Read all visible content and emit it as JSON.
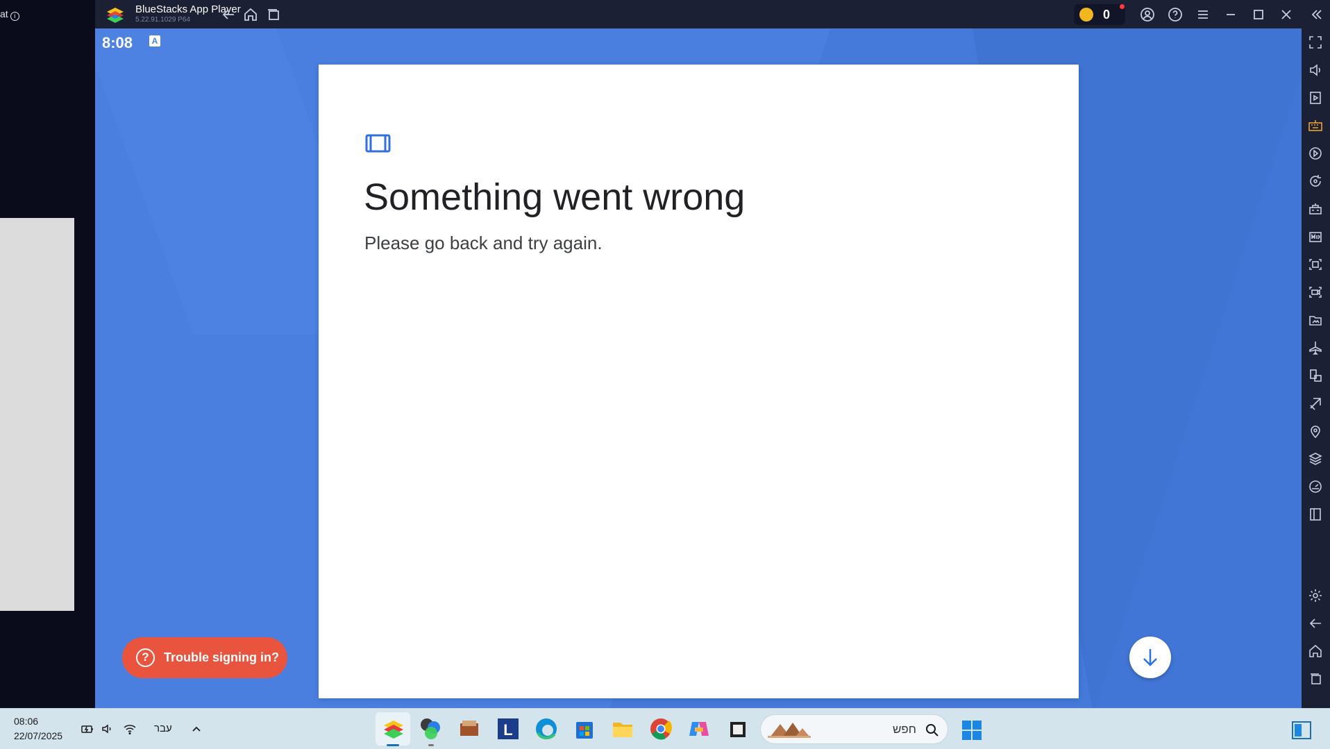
{
  "left_window": {
    "text": "at"
  },
  "titlebar": {
    "app_title": "BlueStacks App Player",
    "app_version": "5.22.91.1029 P64",
    "coins": "0"
  },
  "android": {
    "status_time": "8:08",
    "status_icon_letter": "A",
    "card": {
      "heading": "Something went wrong",
      "subtitle": "Please go back and try again."
    },
    "trouble_button": {
      "icon": "?",
      "label": "Trouble signing in?"
    },
    "scroll_button_icon": "arrow-down-icon"
  },
  "sidebar_icons": [
    "fullscreen-icon",
    "volume-icon",
    "media-manager-icon",
    "keyboard-controls-icon",
    "macro-recorder-icon",
    "rotate-icon",
    "game-controls-icon",
    "install-apk-icon",
    "screenshot-icon",
    "screen-record-icon",
    "folder-icon",
    "airplane-mode-icon",
    "multi-instance-icon",
    "eco-mode-icon",
    "location-icon",
    "layers-icon",
    "performance-icon",
    "sidebar-toggle-icon",
    "settings-icon",
    "back-icon",
    "home-icon",
    "recents-icon"
  ],
  "taskbar": {
    "time": "08:06",
    "date": "22/07/2025",
    "language": "עבר",
    "search_placeholder": "חפש",
    "apps": [
      "bluestacks",
      "multi-instance",
      "app-3",
      "l-app",
      "edge",
      "store",
      "file-explorer",
      "chrome",
      "copilot",
      "app-10"
    ]
  },
  "colors": {
    "android_bg": "#4a7fe0",
    "trouble_button": "#e8543e",
    "titlebar": "#1b2035",
    "taskbar": "#d3e4ec"
  }
}
